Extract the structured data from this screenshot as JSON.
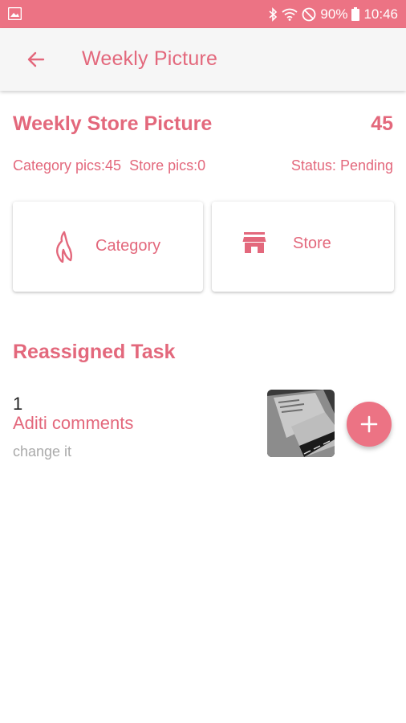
{
  "status_bar": {
    "battery": "90%",
    "time": "10:46",
    "icons": [
      "image-icon",
      "bluetooth-icon",
      "wifi-icon",
      "do-not-disturb-icon",
      "battery-icon"
    ]
  },
  "app_bar": {
    "title": "Weekly Picture",
    "back_icon": "arrow-left-icon"
  },
  "summary": {
    "title": "Weekly Store Picture",
    "count": "45",
    "category_pics": "Category pics:45",
    "store_pics": "Store pics:0",
    "status": "Status: Pending"
  },
  "cards": {
    "category": {
      "label": "Category",
      "icon": "bottle-icon"
    },
    "store": {
      "label": "Store",
      "icon": "store-icon"
    }
  },
  "reassigned": {
    "title": "Reassigned Task",
    "task": {
      "number": "1",
      "author": "Aditi comments",
      "comment": "change it",
      "fab_icon": "plus-icon"
    }
  },
  "colors": {
    "accent": "#e3687c",
    "status_bar": "#ec7384",
    "app_bar": "#f6f6f6"
  }
}
